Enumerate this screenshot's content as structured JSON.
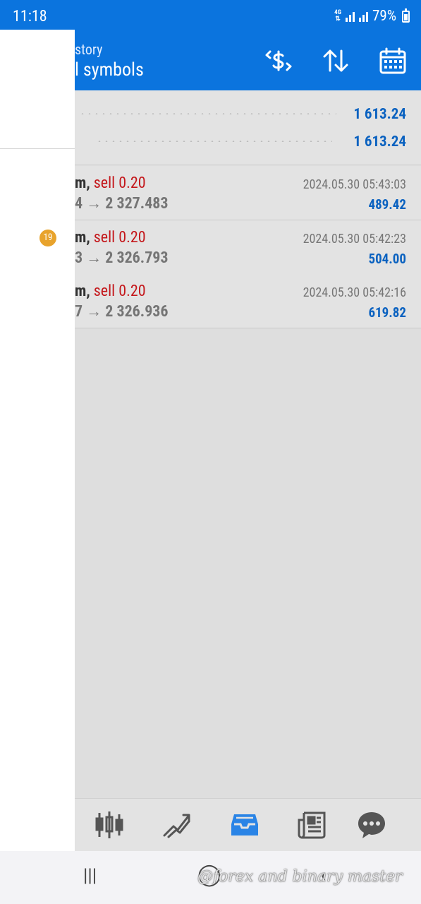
{
  "status_bar": {
    "time": "11:18",
    "network": "4G",
    "battery": "79%"
  },
  "header": {
    "subtitle": "story",
    "title": "ll symbols"
  },
  "summary": {
    "row1_value": "1 613.24",
    "row2_value": "1 613.24"
  },
  "deals": [
    {
      "symbol": "m,",
      "action": "sell 0.20",
      "prices": "4 → 2 327.483",
      "datetime": "2024.05.30 05:43:03",
      "profit": "489.42"
    },
    {
      "symbol": "m,",
      "action": "sell 0.20",
      "prices": "3 → 2 326.793",
      "datetime": "2024.05.30 05:42:23",
      "profit": "504.00"
    },
    {
      "symbol": "m,",
      "action": "sell 0.20",
      "prices": "7 → 2 326.936",
      "datetime": "2024.05.30 05:42:16",
      "profit": "619.82"
    }
  ],
  "drawer": {
    "badge_count": "19"
  },
  "tabs": [
    {
      "icon": "quotes-candles-icon"
    },
    {
      "icon": "chart-trend-icon"
    },
    {
      "icon": "inbox-trade-icon",
      "active": true
    },
    {
      "icon": "news-icon"
    },
    {
      "icon": "chat-icon"
    }
  ],
  "watermark": "@forex and binary master",
  "colors": {
    "accent": "#0b74de",
    "sell": "#c4171b",
    "profit": "#0b62c0",
    "badge": "#e8a32c"
  }
}
